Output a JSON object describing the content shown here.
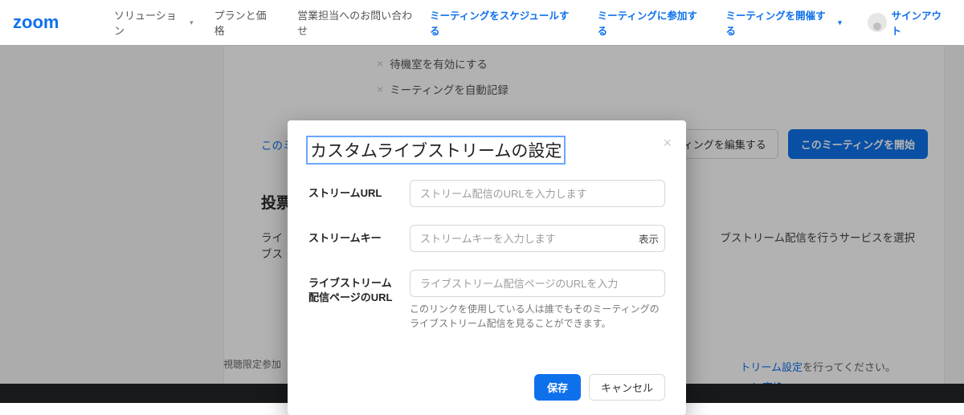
{
  "nav": {
    "logo_text": "zoom",
    "left": [
      {
        "label": "ソリューション",
        "has_caret": true
      },
      {
        "label": "プランと価格",
        "has_caret": false
      },
      {
        "label": "営業担当へのお問い合わせ",
        "has_caret": false
      }
    ],
    "right": [
      {
        "label": "ミーティングをスケジュールする",
        "has_caret": false
      },
      {
        "label": "ミーティングに参加する",
        "has_caret": false
      },
      {
        "label": "ミーティングを開催する",
        "has_caret": true
      }
    ],
    "signout_label": "サインアウト"
  },
  "background": {
    "disabled_options": [
      "待機室を有効にする",
      "ミーティングを自動記録"
    ],
    "link_delete_prefix": "このミ",
    "edit_button_suffix": "ディングを編集する",
    "start_button_label": "このミーティングを開始",
    "section_title": "投票",
    "live_left_label": "ライブス",
    "live_right_text_suffix": "ブストリーム配信を行うサービスを選択",
    "note_prefix": "",
    "note_link": "トリーム設定",
    "note_suffix": "を行ってください。",
    "note2_suffix": "に変換",
    "footer_note": "視聴限定参加"
  },
  "modal": {
    "title": "カスタムライブストリームの設定",
    "close_sr": "閉じる",
    "stream_url_label": "ストリームURL",
    "stream_url_placeholder": "ストリーム配信のURLを入力します",
    "stream_url_value": "",
    "stream_key_label": "ストリームキー",
    "stream_key_placeholder": "ストリームキーを入力します",
    "stream_key_value": "",
    "show_label": "表示",
    "page_url_label": "ライブストリーム配信ページのURL",
    "page_url_placeholder": "ライブストリーム配信ページのURLを入力",
    "page_url_value": "",
    "helper_text": "このリンクを使用している人は誰でもそのミーティングのライブストリーム配信を見ることができます。",
    "save_label": "保存",
    "cancel_label": "キャンセル"
  },
  "colors": {
    "brand_blue": "#0e71eb"
  }
}
